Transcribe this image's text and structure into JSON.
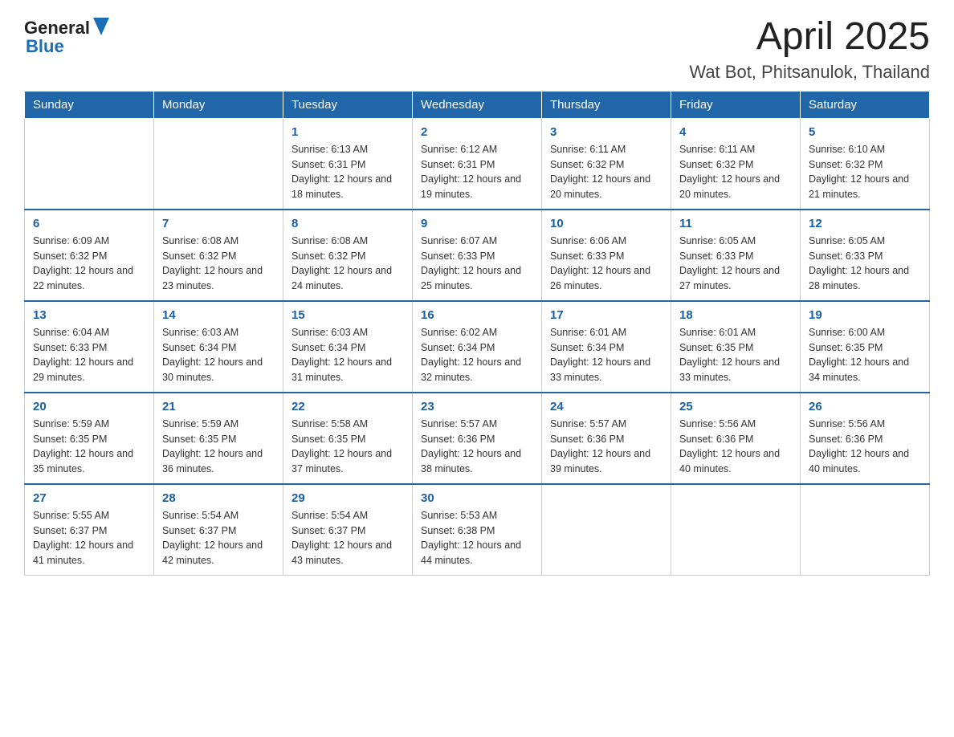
{
  "header": {
    "logo_general": "General",
    "logo_blue": "Blue",
    "month_year": "April 2025",
    "location": "Wat Bot, Phitsanulok, Thailand"
  },
  "weekdays": [
    "Sunday",
    "Monday",
    "Tuesday",
    "Wednesday",
    "Thursday",
    "Friday",
    "Saturday"
  ],
  "weeks": [
    [
      {
        "day": "",
        "sunrise": "",
        "sunset": "",
        "daylight": ""
      },
      {
        "day": "",
        "sunrise": "",
        "sunset": "",
        "daylight": ""
      },
      {
        "day": "1",
        "sunrise": "Sunrise: 6:13 AM",
        "sunset": "Sunset: 6:31 PM",
        "daylight": "Daylight: 12 hours and 18 minutes."
      },
      {
        "day": "2",
        "sunrise": "Sunrise: 6:12 AM",
        "sunset": "Sunset: 6:31 PM",
        "daylight": "Daylight: 12 hours and 19 minutes."
      },
      {
        "day": "3",
        "sunrise": "Sunrise: 6:11 AM",
        "sunset": "Sunset: 6:32 PM",
        "daylight": "Daylight: 12 hours and 20 minutes."
      },
      {
        "day": "4",
        "sunrise": "Sunrise: 6:11 AM",
        "sunset": "Sunset: 6:32 PM",
        "daylight": "Daylight: 12 hours and 20 minutes."
      },
      {
        "day": "5",
        "sunrise": "Sunrise: 6:10 AM",
        "sunset": "Sunset: 6:32 PM",
        "daylight": "Daylight: 12 hours and 21 minutes."
      }
    ],
    [
      {
        "day": "6",
        "sunrise": "Sunrise: 6:09 AM",
        "sunset": "Sunset: 6:32 PM",
        "daylight": "Daylight: 12 hours and 22 minutes."
      },
      {
        "day": "7",
        "sunrise": "Sunrise: 6:08 AM",
        "sunset": "Sunset: 6:32 PM",
        "daylight": "Daylight: 12 hours and 23 minutes."
      },
      {
        "day": "8",
        "sunrise": "Sunrise: 6:08 AM",
        "sunset": "Sunset: 6:32 PM",
        "daylight": "Daylight: 12 hours and 24 minutes."
      },
      {
        "day": "9",
        "sunrise": "Sunrise: 6:07 AM",
        "sunset": "Sunset: 6:33 PM",
        "daylight": "Daylight: 12 hours and 25 minutes."
      },
      {
        "day": "10",
        "sunrise": "Sunrise: 6:06 AM",
        "sunset": "Sunset: 6:33 PM",
        "daylight": "Daylight: 12 hours and 26 minutes."
      },
      {
        "day": "11",
        "sunrise": "Sunrise: 6:05 AM",
        "sunset": "Sunset: 6:33 PM",
        "daylight": "Daylight: 12 hours and 27 minutes."
      },
      {
        "day": "12",
        "sunrise": "Sunrise: 6:05 AM",
        "sunset": "Sunset: 6:33 PM",
        "daylight": "Daylight: 12 hours and 28 minutes."
      }
    ],
    [
      {
        "day": "13",
        "sunrise": "Sunrise: 6:04 AM",
        "sunset": "Sunset: 6:33 PM",
        "daylight": "Daylight: 12 hours and 29 minutes."
      },
      {
        "day": "14",
        "sunrise": "Sunrise: 6:03 AM",
        "sunset": "Sunset: 6:34 PM",
        "daylight": "Daylight: 12 hours and 30 minutes."
      },
      {
        "day": "15",
        "sunrise": "Sunrise: 6:03 AM",
        "sunset": "Sunset: 6:34 PM",
        "daylight": "Daylight: 12 hours and 31 minutes."
      },
      {
        "day": "16",
        "sunrise": "Sunrise: 6:02 AM",
        "sunset": "Sunset: 6:34 PM",
        "daylight": "Daylight: 12 hours and 32 minutes."
      },
      {
        "day": "17",
        "sunrise": "Sunrise: 6:01 AM",
        "sunset": "Sunset: 6:34 PM",
        "daylight": "Daylight: 12 hours and 33 minutes."
      },
      {
        "day": "18",
        "sunrise": "Sunrise: 6:01 AM",
        "sunset": "Sunset: 6:35 PM",
        "daylight": "Daylight: 12 hours and 33 minutes."
      },
      {
        "day": "19",
        "sunrise": "Sunrise: 6:00 AM",
        "sunset": "Sunset: 6:35 PM",
        "daylight": "Daylight: 12 hours and 34 minutes."
      }
    ],
    [
      {
        "day": "20",
        "sunrise": "Sunrise: 5:59 AM",
        "sunset": "Sunset: 6:35 PM",
        "daylight": "Daylight: 12 hours and 35 minutes."
      },
      {
        "day": "21",
        "sunrise": "Sunrise: 5:59 AM",
        "sunset": "Sunset: 6:35 PM",
        "daylight": "Daylight: 12 hours and 36 minutes."
      },
      {
        "day": "22",
        "sunrise": "Sunrise: 5:58 AM",
        "sunset": "Sunset: 6:35 PM",
        "daylight": "Daylight: 12 hours and 37 minutes."
      },
      {
        "day": "23",
        "sunrise": "Sunrise: 5:57 AM",
        "sunset": "Sunset: 6:36 PM",
        "daylight": "Daylight: 12 hours and 38 minutes."
      },
      {
        "day": "24",
        "sunrise": "Sunrise: 5:57 AM",
        "sunset": "Sunset: 6:36 PM",
        "daylight": "Daylight: 12 hours and 39 minutes."
      },
      {
        "day": "25",
        "sunrise": "Sunrise: 5:56 AM",
        "sunset": "Sunset: 6:36 PM",
        "daylight": "Daylight: 12 hours and 40 minutes."
      },
      {
        "day": "26",
        "sunrise": "Sunrise: 5:56 AM",
        "sunset": "Sunset: 6:36 PM",
        "daylight": "Daylight: 12 hours and 40 minutes."
      }
    ],
    [
      {
        "day": "27",
        "sunrise": "Sunrise: 5:55 AM",
        "sunset": "Sunset: 6:37 PM",
        "daylight": "Daylight: 12 hours and 41 minutes."
      },
      {
        "day": "28",
        "sunrise": "Sunrise: 5:54 AM",
        "sunset": "Sunset: 6:37 PM",
        "daylight": "Daylight: 12 hours and 42 minutes."
      },
      {
        "day": "29",
        "sunrise": "Sunrise: 5:54 AM",
        "sunset": "Sunset: 6:37 PM",
        "daylight": "Daylight: 12 hours and 43 minutes."
      },
      {
        "day": "30",
        "sunrise": "Sunrise: 5:53 AM",
        "sunset": "Sunset: 6:38 PM",
        "daylight": "Daylight: 12 hours and 44 minutes."
      },
      {
        "day": "",
        "sunrise": "",
        "sunset": "",
        "daylight": ""
      },
      {
        "day": "",
        "sunrise": "",
        "sunset": "",
        "daylight": ""
      },
      {
        "day": "",
        "sunrise": "",
        "sunset": "",
        "daylight": ""
      }
    ]
  ]
}
